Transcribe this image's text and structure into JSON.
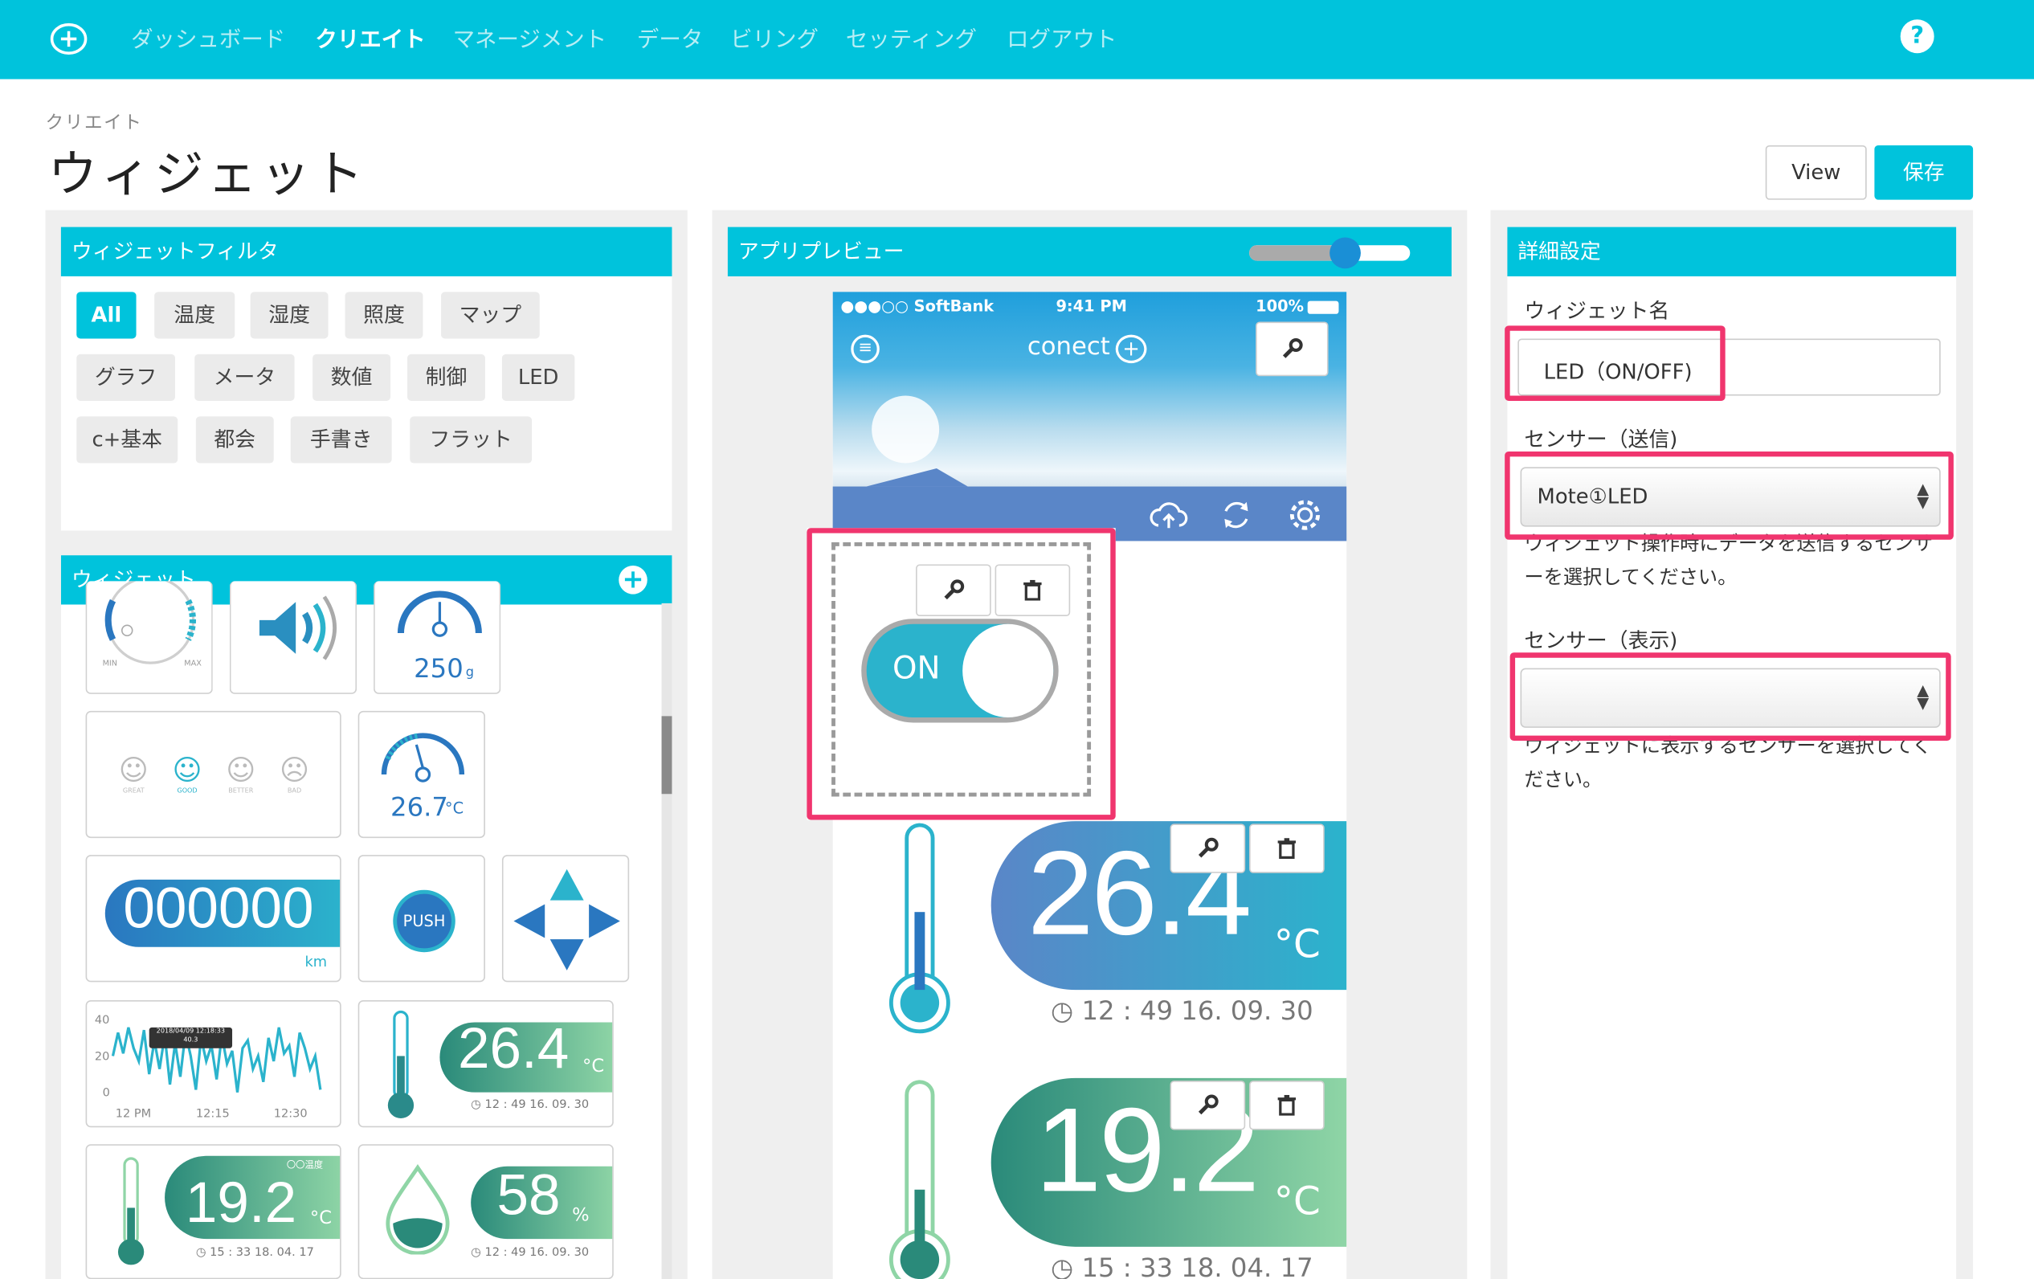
{
  "nav": {
    "items": [
      "ダッシュボード",
      "クリエイト",
      "マネージメント",
      "データ",
      "ビリング",
      "セッティング",
      "ログアウト"
    ],
    "active_index": 1,
    "help_label": "?"
  },
  "breadcrumb": "クリエイト",
  "page_title": "ウィジェット",
  "buttons": {
    "view": "View",
    "save": "保存"
  },
  "filter_panel": {
    "title": "ウィジェットフィルタ",
    "chips": [
      "All",
      "温度",
      "湿度",
      "照度",
      "マップ",
      "グラフ",
      "メータ",
      "数値",
      "制御",
      "LED",
      "c+基本",
      "都会",
      "手書き",
      "フラット"
    ],
    "selected": "All"
  },
  "widget_panel": {
    "title": "ウィジェット",
    "knob": {
      "min": "MIN",
      "max": "MAX"
    },
    "scale_value": "250",
    "scale_unit": "g",
    "faces": [
      "GREAT",
      "GOOD",
      "BETTER",
      "BAD"
    ],
    "meter_value": "26.7",
    "meter_unit": "°C",
    "counter_value": "000000",
    "counter_unit": "km",
    "push_label": "PUSH",
    "graph": {
      "y_labels": [
        "40",
        "20",
        "0"
      ],
      "x_labels": [
        "12 PM",
        "12:15",
        "12:30"
      ],
      "tooltip_date": "2018/04/09 12:18:33",
      "tooltip_value": "40.3"
    },
    "temp1": {
      "value": "26.4",
      "unit": "°C",
      "time": "12 : 49 16. 09. 30"
    },
    "temp2": {
      "value": "19.2",
      "unit": "°C",
      "time": "15 : 33 18. 04. 17",
      "tag": "〇〇温度"
    },
    "humid": {
      "value": "58",
      "unit": "%",
      "time": "12 : 49 16. 09. 30"
    }
  },
  "preview_panel": {
    "title": "アプリプレビュー",
    "zoom_level": 0.6,
    "status": {
      "carrier": "●●●○○ SoftBank",
      "time": "9:41 PM",
      "battery": "100%"
    },
    "app_logo": "conect",
    "switch_label": "ON",
    "temp1": {
      "value": "26.4",
      "unit": "°C",
      "time": "12 : 49 16. 09. 30"
    },
    "temp2": {
      "value": "19.2",
      "unit": "°C",
      "time": "15 : 33 18. 04. 17"
    }
  },
  "detail_panel": {
    "title": "詳細設定",
    "name_label": "ウィジェット名",
    "name_value": "LED（ON/OFF)",
    "send_label": "センサー（送信)",
    "send_value": "Mote①LED",
    "send_help": "ウィジェット操作時にデータを送信するセンサーを選択してください。",
    "display_label": "センサー（表示)",
    "display_value": "",
    "display_help": "ウィジェットに表示するセンサーを選択してください。"
  },
  "colors": {
    "accent": "#00c3dc",
    "highlight": "#f0356e",
    "teal": "#2bb3cc",
    "green": "#8fd5a6"
  }
}
